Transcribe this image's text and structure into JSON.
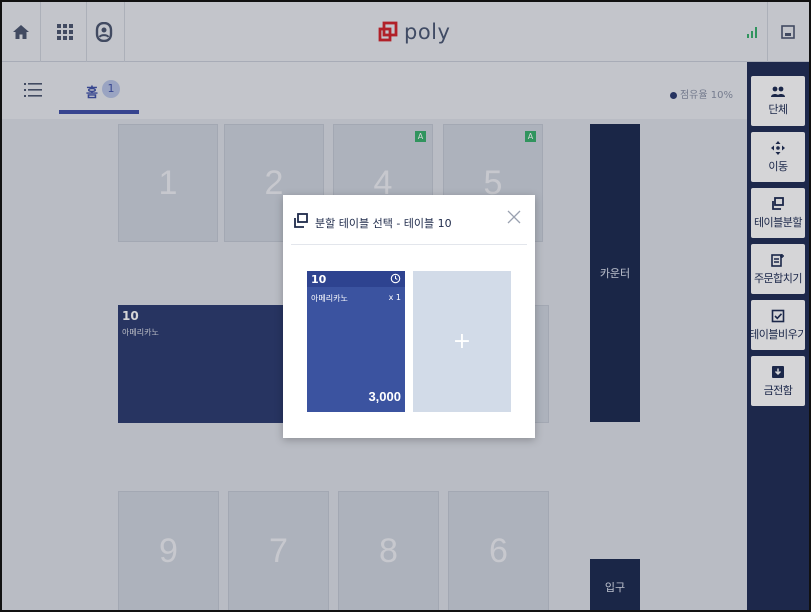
{
  "app": {
    "logo_text": "poly"
  },
  "tabs": [
    {
      "label": "홈",
      "count": "1"
    }
  ],
  "occupancy": "점유율 10%",
  "floor_tiles": [
    {
      "num": "1",
      "badge": ""
    },
    {
      "num": "2",
      "badge": ""
    },
    {
      "num": "4",
      "badge": "A"
    },
    {
      "num": "5",
      "badge": "A"
    },
    {
      "num": "9",
      "badge": ""
    },
    {
      "num": "7",
      "badge": ""
    },
    {
      "num": "8",
      "badge": ""
    },
    {
      "num": "6",
      "badge": ""
    }
  ],
  "occupied_table": {
    "num": "10",
    "menu": "아메리카노"
  },
  "counter_label": "카운터",
  "entrance_label": "입구",
  "right_panel": [
    {
      "label": "단체",
      "icon": "group-icon"
    },
    {
      "label": "이동",
      "icon": "move-icon"
    },
    {
      "label": "테이블분할",
      "icon": "split-table-icon"
    },
    {
      "label": "주문합치기",
      "icon": "merge-order-icon"
    },
    {
      "label": "테이블비우기",
      "icon": "clear-table-icon"
    },
    {
      "label": "금전함",
      "icon": "cash-drawer-icon"
    }
  ],
  "modal": {
    "title": "분할 테이블 선택 - 테이블 10",
    "card": {
      "num": "10",
      "item": "아메리카노",
      "qty": "x 1",
      "total": "3,000"
    },
    "add_symbol": "+"
  },
  "colors": {
    "accent": "#3f4fa8",
    "dark_panel": "#1f2c55",
    "occupied": "#2b3b6f",
    "badge": "#37b06c"
  }
}
